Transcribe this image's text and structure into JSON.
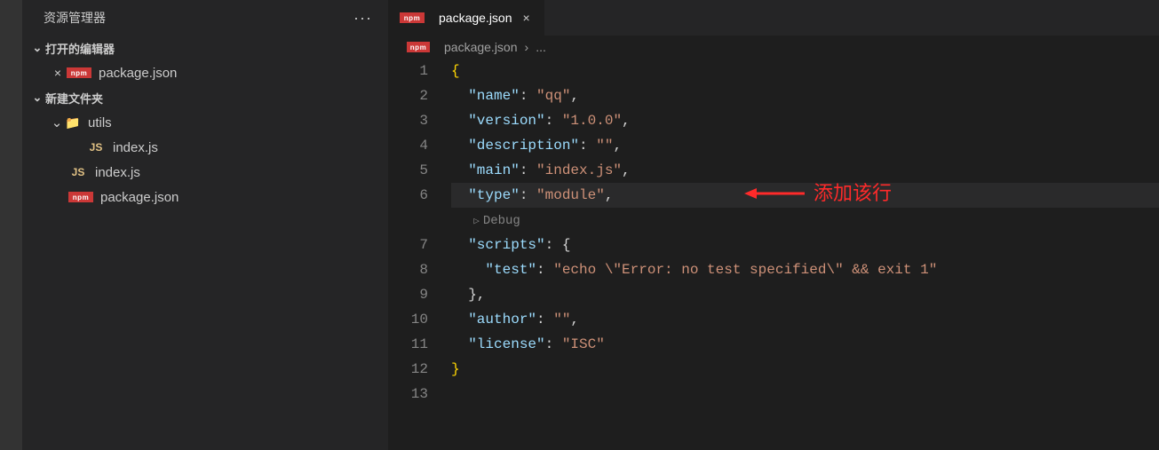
{
  "sidebar": {
    "title": "资源管理器",
    "openEditorsLabel": "打开的编辑器",
    "openEditors": [
      {
        "name": "package.json",
        "iconText": "npm"
      }
    ],
    "folderLabel": "新建文件夹",
    "tree": {
      "utils": {
        "name": "utils",
        "children": [
          {
            "name": "index.js",
            "iconText": "JS"
          }
        ]
      },
      "rootFiles": [
        {
          "name": "index.js",
          "iconText": "JS"
        },
        {
          "name": "package.json",
          "iconText": "npm"
        }
      ]
    }
  },
  "tabs": {
    "active": {
      "name": "package.json",
      "iconText": "npm"
    }
  },
  "breadcrumb": {
    "file": "package.json",
    "iconText": "npm",
    "tail": "..."
  },
  "debugLens": "Debug",
  "annotation": "添加该行",
  "lineNumbers": [
    "1",
    "2",
    "3",
    "4",
    "5",
    "6",
    "",
    "7",
    "8",
    "9",
    "10",
    "11",
    "12",
    "13"
  ],
  "code": {
    "l1_brace": "{",
    "l2_key": "\"name\"",
    "l2_val": "\"qq\"",
    "l3_key": "\"version\"",
    "l3_val": "\"1.0.0\"",
    "l4_key": "\"description\"",
    "l4_val": "\"\"",
    "l5_key": "\"main\"",
    "l5_val": "\"index.js\"",
    "l6_key": "\"type\"",
    "l6_val": "\"module\"",
    "l7_key": "\"scripts\"",
    "l8_key": "\"test\"",
    "l8_val": "\"echo \\\"Error: no test specified\\\" && exit 1\"",
    "l10_key": "\"author\"",
    "l10_val": "\"\"",
    "l11_key": "\"license\"",
    "l11_val": "\"ISC\"",
    "l12_brace": "}"
  }
}
